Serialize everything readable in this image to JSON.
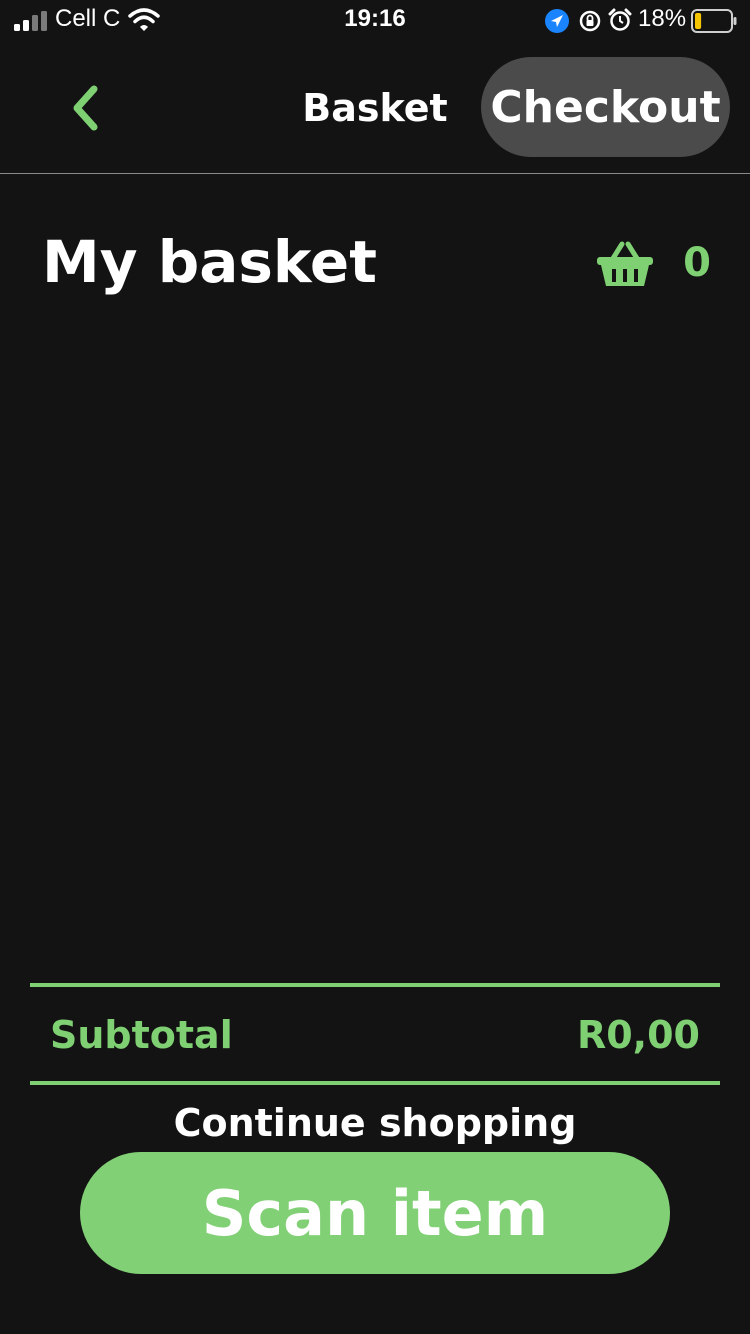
{
  "status_bar": {
    "carrier": "Cell C",
    "time": "19:16",
    "battery_percent": "18%",
    "battery_level": 0.18,
    "icons": [
      "signal-icon",
      "wifi-icon",
      "location-icon",
      "rotation-lock-icon",
      "alarm-icon",
      "battery-icon"
    ]
  },
  "nav": {
    "back_icon": "chevron-left-icon",
    "title": "Basket",
    "checkout_label": "Checkout"
  },
  "main": {
    "title": "My basket",
    "basket_icon": "basket-icon",
    "item_count": "0"
  },
  "summary": {
    "subtotal_label": "Subtotal",
    "subtotal_value": "R0,00"
  },
  "actions": {
    "continue_label": "Continue shopping",
    "scan_label": "Scan item"
  },
  "colors": {
    "background": "#131313",
    "accent": "#7fd073",
    "checkout_bg": "#4b4b4b"
  }
}
